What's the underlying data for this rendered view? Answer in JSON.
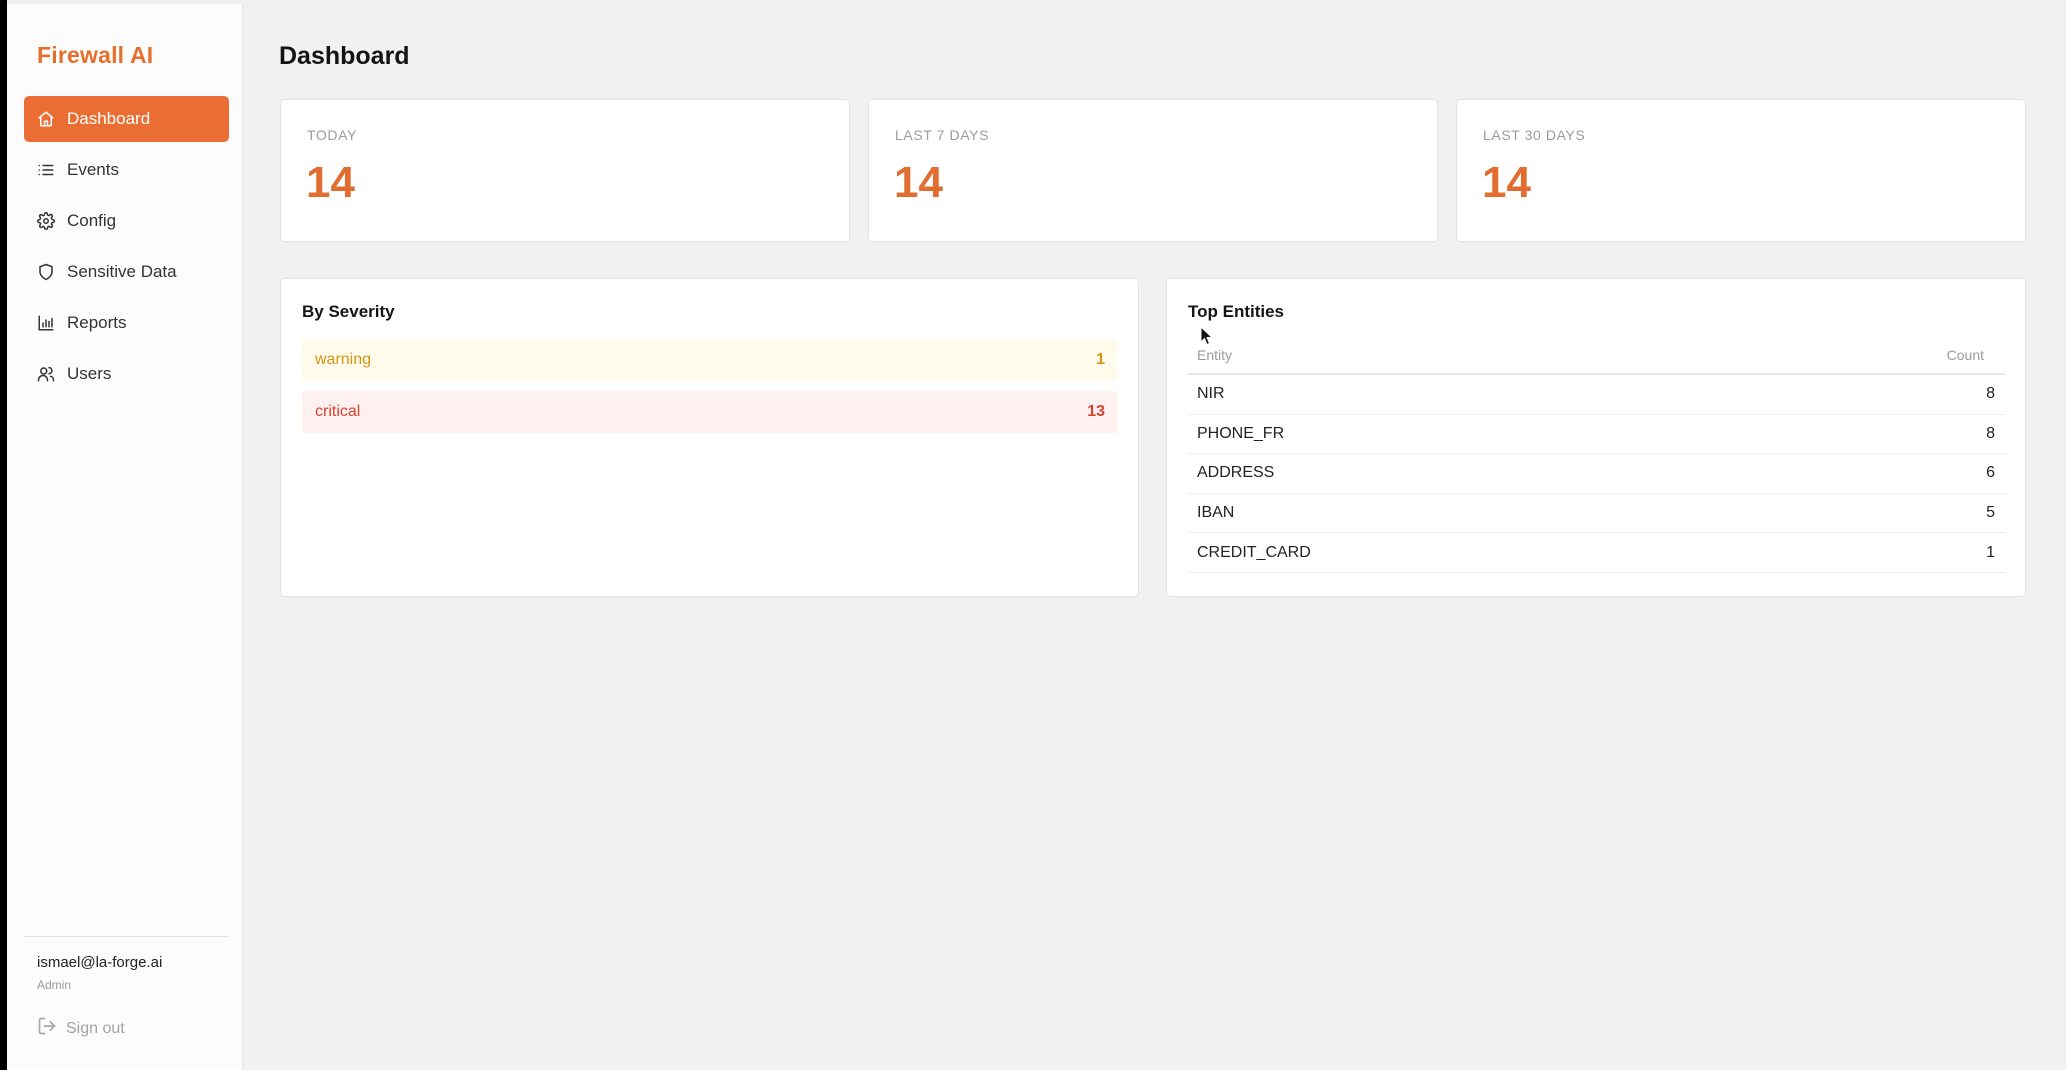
{
  "app": {
    "brand": "Firewall AI"
  },
  "sidebar": {
    "items": [
      {
        "label": "Dashboard",
        "icon": "home-icon",
        "active": true
      },
      {
        "label": "Events",
        "icon": "list-icon"
      },
      {
        "label": "Config",
        "icon": "gear-icon"
      },
      {
        "label": "Sensitive Data",
        "icon": "shield-icon"
      },
      {
        "label": "Reports",
        "icon": "bar-chart-icon"
      },
      {
        "label": "Users",
        "icon": "users-icon"
      }
    ],
    "user": {
      "email": "ismael@la-forge.ai",
      "role": "Admin"
    },
    "signout_label": "Sign out"
  },
  "main": {
    "title": "Dashboard",
    "stats": [
      {
        "label": "TODAY",
        "value": "14"
      },
      {
        "label": "LAST 7 DAYS",
        "value": "14"
      },
      {
        "label": "LAST 30 DAYS",
        "value": "14"
      }
    ],
    "severity": {
      "title": "By Severity",
      "rows": [
        {
          "label": "warning",
          "count": "1"
        },
        {
          "label": "critical",
          "count": "13"
        }
      ]
    },
    "entities": {
      "title": "Top Entities",
      "columns": [
        "Entity",
        "Count"
      ],
      "rows": [
        {
          "entity": "NIR",
          "count": "8"
        },
        {
          "entity": "PHONE_FR",
          "count": "8"
        },
        {
          "entity": "ADDRESS",
          "count": "6"
        },
        {
          "entity": "IBAN",
          "count": "5"
        },
        {
          "entity": "CREDIT_CARD",
          "count": "1"
        }
      ]
    }
  },
  "colors": {
    "accent": "#ea6e33",
    "warning": "#d39515",
    "critical": "#d6432f"
  }
}
